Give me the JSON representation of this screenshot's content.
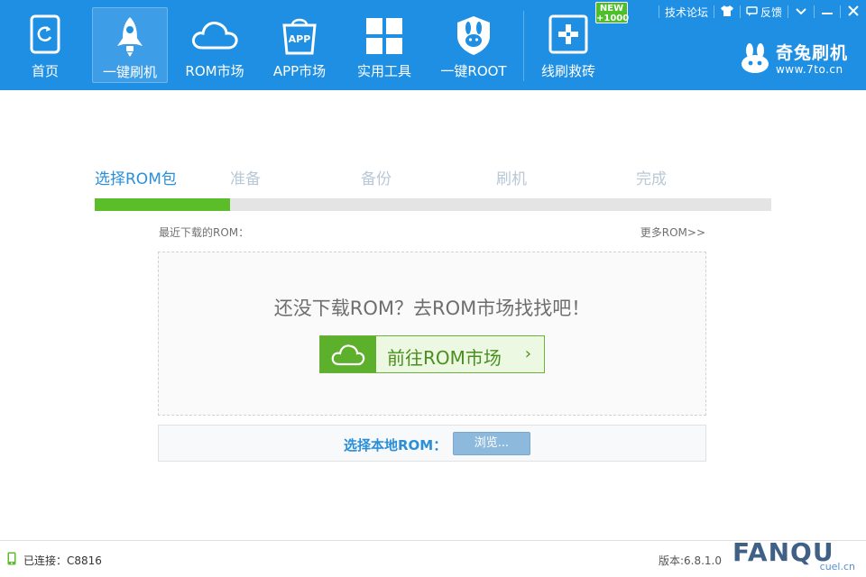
{
  "nav": {
    "items": [
      {
        "label": "首页",
        "icon": "phone-icon",
        "active": false
      },
      {
        "label": "一键刷机",
        "icon": "rocket-icon",
        "active": true
      },
      {
        "label": "ROM市场",
        "icon": "cloud-icon",
        "active": false
      },
      {
        "label": "APP市场",
        "icon": "shopping-bag-icon",
        "active": false,
        "icon_text": "APP"
      },
      {
        "label": "实用工具",
        "icon": "grid-icon",
        "active": false
      },
      {
        "label": "一键ROOT",
        "icon": "rabbit-shield-icon",
        "active": false
      },
      {
        "label": "线刷救砖",
        "icon": "first-aid-icon",
        "active": false
      }
    ],
    "new_badge": {
      "line1": "NEW",
      "line2": "+1000"
    }
  },
  "top_links": {
    "forum": "技术论坛",
    "feedback": "反馈"
  },
  "logo": {
    "name": "奇兔刷机",
    "url": "www.7to.cn"
  },
  "steps": {
    "items": [
      "选择ROM包",
      "准备",
      "备份",
      "刷机",
      "完成"
    ],
    "current_index": 0,
    "progress_fraction": 0.2
  },
  "recent": {
    "label": "最近下载的ROM：",
    "more_link": "更多ROM>>",
    "empty_message": "还没下载ROM？去ROM市场找找吧！",
    "market_button": "前往ROM市场",
    "market_chevron": "›"
  },
  "local_rom": {
    "label": "选择本地ROM：",
    "browse_button": "浏览..."
  },
  "status": {
    "connection": "已连接：C8816",
    "version": "版本:6.8.1.0"
  },
  "watermark": {
    "main": "FANQU",
    "sub": "cuel.cn"
  },
  "colors": {
    "header_bg": "#1e8fe3",
    "accent_blue": "#2a8fd8",
    "progress_green": "#5cbd2a",
    "market_green": "#5db02b"
  }
}
